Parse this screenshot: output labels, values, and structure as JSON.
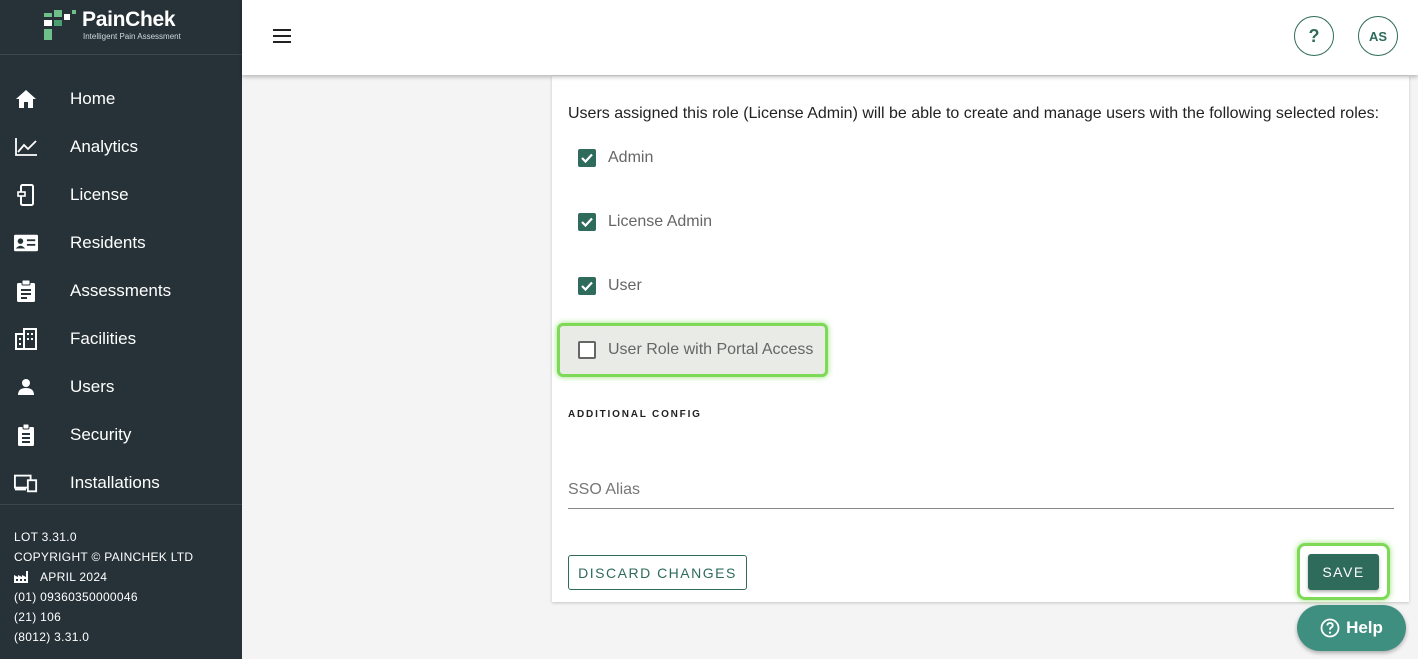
{
  "brand": {
    "name": "PainChek",
    "tagline": "Intelligent Pain Assessment"
  },
  "sidebar": {
    "items": [
      {
        "label": "Home",
        "icon": "home-icon"
      },
      {
        "label": "Analytics",
        "icon": "analytics-icon"
      },
      {
        "label": "License",
        "icon": "license-icon"
      },
      {
        "label": "Residents",
        "icon": "residents-icon"
      },
      {
        "label": "Assessments",
        "icon": "assessments-icon"
      },
      {
        "label": "Facilities",
        "icon": "facilities-icon"
      },
      {
        "label": "Users",
        "icon": "users-icon"
      },
      {
        "label": "Security",
        "icon": "security-icon"
      },
      {
        "label": "Installations",
        "icon": "installations-icon"
      }
    ],
    "meta": {
      "lot": "LOT 3.31.0",
      "copyright": "COPYRIGHT © PAINCHEK LTD",
      "date": "APRIL 2024",
      "udi1": "(01) 09360350000046",
      "udi2": "(21) 106",
      "udi3": "(8012) 3.31.0"
    }
  },
  "header": {
    "help_label": "?",
    "avatar_initials": "AS"
  },
  "main": {
    "description": "Users assigned this role (License Admin) will be able to create and manage users with the following selected roles:",
    "roles": [
      {
        "label": "Admin",
        "checked": true
      },
      {
        "label": "License Admin",
        "checked": true
      },
      {
        "label": "User",
        "checked": true
      },
      {
        "label": "User Role with Portal Access",
        "checked": false
      }
    ],
    "additional_config_title": "ADDITIONAL CONFIG",
    "sso_alias_placeholder": "SSO Alias",
    "discard_label": "DISCARD CHANGES",
    "save_label": "SAVE"
  },
  "help_fab": {
    "label": "Help"
  },
  "colors": {
    "sidebar_bg": "#263238",
    "accent": "#2e6b5a",
    "highlight": "#7ed957",
    "fab": "#3f8f80"
  }
}
